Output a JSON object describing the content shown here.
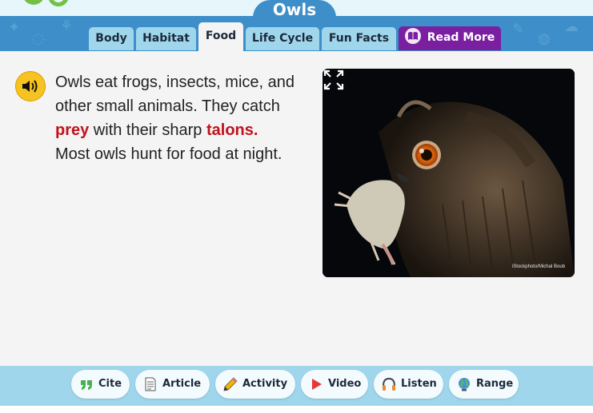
{
  "header": {
    "title": "Owls"
  },
  "tabs": [
    {
      "label": "Body"
    },
    {
      "label": "Habitat"
    },
    {
      "label": "Food"
    },
    {
      "label": "Life Cycle"
    },
    {
      "label": "Fun Facts"
    },
    {
      "label": "Read More"
    }
  ],
  "active_tab": "Food",
  "content": {
    "t1": "Owls eat frogs, insects, mice, and other small animals. They catch ",
    "prey": "prey",
    "t2": " with their sharp ",
    "talons": "talons.",
    "t3": " Most owls hunt for food at night.",
    "highlight_color": "#c0121c"
  },
  "photo": {
    "credit": "iStockphoto/Michal Boub"
  },
  "toolbar": [
    {
      "label": "Cite",
      "icon": "quote-icon"
    },
    {
      "label": "Article",
      "icon": "article-icon"
    },
    {
      "label": "Activity",
      "icon": "pencil-icon"
    },
    {
      "label": "Video",
      "icon": "play-icon"
    },
    {
      "label": "Listen",
      "icon": "headphones-icon"
    },
    {
      "label": "Range",
      "icon": "globe-icon"
    }
  ],
  "colors": {
    "brand_blue": "#3d8ec9",
    "tab_blue": "#9fd6ec",
    "read_more_purple": "#7a1fa0",
    "speaker_yellow": "#f7c322"
  }
}
